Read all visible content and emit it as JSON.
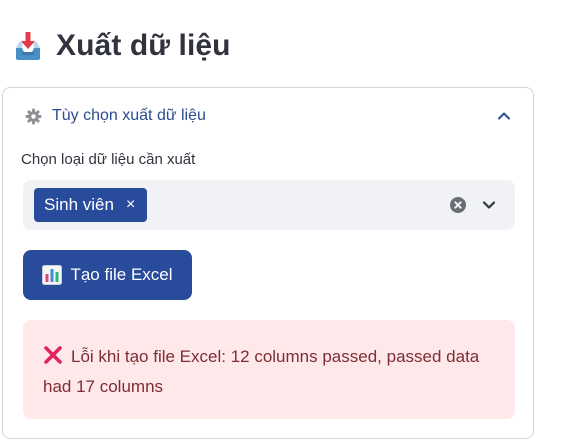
{
  "header": {
    "icon": "inbox-tray-download-icon",
    "title": "Xuất dữ liệu"
  },
  "expander": {
    "icon": "gear-icon",
    "label": "Tùy chọn xuất dữ liệu",
    "expanded": true,
    "toggle_icon": "chevron-up-icon"
  },
  "select": {
    "label": "Chọn loại dữ liệu cần xuất",
    "selected": [
      {
        "label": "Sinh viên",
        "remove": "×"
      }
    ],
    "clear_icon": "clear-circle-icon",
    "dropdown_icon": "chevron-down-icon"
  },
  "button": {
    "icon": "bar-chart-icon",
    "label": "Tạo file Excel"
  },
  "error": {
    "icon": "red-x-icon",
    "message": "Lỗi khi tạo file Excel: 12 columns passed, passed data had 17 columns"
  },
  "colors": {
    "primary": "#284b9c",
    "title": "#31333f",
    "expander_label": "#2b4c8f",
    "select_bg": "#f0f2f6",
    "error_bg": "#ffe8ea",
    "error_text": "#7d2d33",
    "error_icon": "#e0245e"
  }
}
